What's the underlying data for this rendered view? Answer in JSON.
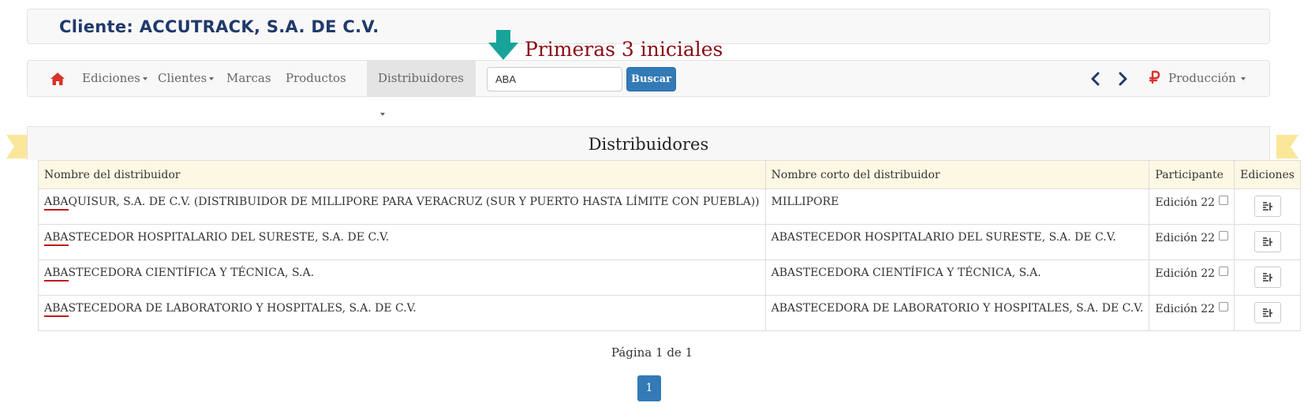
{
  "header": {
    "client_title": "Cliente: ACCUTRACK, S.A. DE C.V."
  },
  "annotation": {
    "text": "Primeras 3 iniciales",
    "arrow_color": "#17a39a",
    "text_color": "#8b0a12"
  },
  "navbar": {
    "home_icon": "home-icon",
    "items": [
      {
        "label": "Ediciones",
        "dropdown": true,
        "active": false
      },
      {
        "label": "Clientes",
        "dropdown": true,
        "active": false
      },
      {
        "label": "Marcas",
        "dropdown": false,
        "active": false
      },
      {
        "label": "Productos",
        "dropdown": false,
        "active": false
      },
      {
        "label": "Distribuidores",
        "dropdown": true,
        "active": true
      }
    ],
    "search": {
      "value": "ABA",
      "button_label": "Buscar"
    },
    "prev_icon": "chevron-left-icon",
    "next_icon": "chevron-right-icon",
    "environment": {
      "label": "Producción",
      "icon": "ruble-icon"
    }
  },
  "panel": {
    "title": "Distribuidores"
  },
  "table": {
    "columns": [
      "Nombre del distribuidor",
      "Nombre corto del distribuidor",
      "Participante",
      "Ediciones"
    ],
    "highlight_prefix": "ABA",
    "rows": [
      {
        "name_rest": "QUISUR, S.A. DE C.V. (DISTRIBUIDOR DE MILLIPORE PARA VERACRUZ (SUR Y PUERTO HASTA LÍMITE CON PUEBLA))",
        "short": "MILLIPORE",
        "participant": "Edición 22",
        "checked": false
      },
      {
        "name_rest": "STECEDOR HOSPITALARIO DEL SURESTE, S.A. DE C.V.",
        "short": "ABASTECEDOR HOSPITALARIO DEL SURESTE, S.A. DE C.V.",
        "participant": "Edición 22",
        "checked": false
      },
      {
        "name_rest": "STECEDORA CIENTÍFICA Y TÉCNICA, S.A.",
        "short": "ABASTECEDORA CIENTÍFICA Y TÉCNICA, S.A.",
        "participant": "Edición 22",
        "checked": false
      },
      {
        "name_rest": "STECEDORA DE LABORATORIO Y HOSPITALES, S.A. DE C.V.",
        "short": "ABASTECEDORA DE LABORATORIO Y HOSPITALES, S.A. DE C.V.",
        "participant": "Edición 22",
        "checked": false
      }
    ]
  },
  "pagination": {
    "text": "Página 1 de 1",
    "current": "1"
  },
  "colors": {
    "primary": "#337ab7",
    "table_header_bg": "#fdf8e3",
    "ribbon": "#fbe79a"
  }
}
